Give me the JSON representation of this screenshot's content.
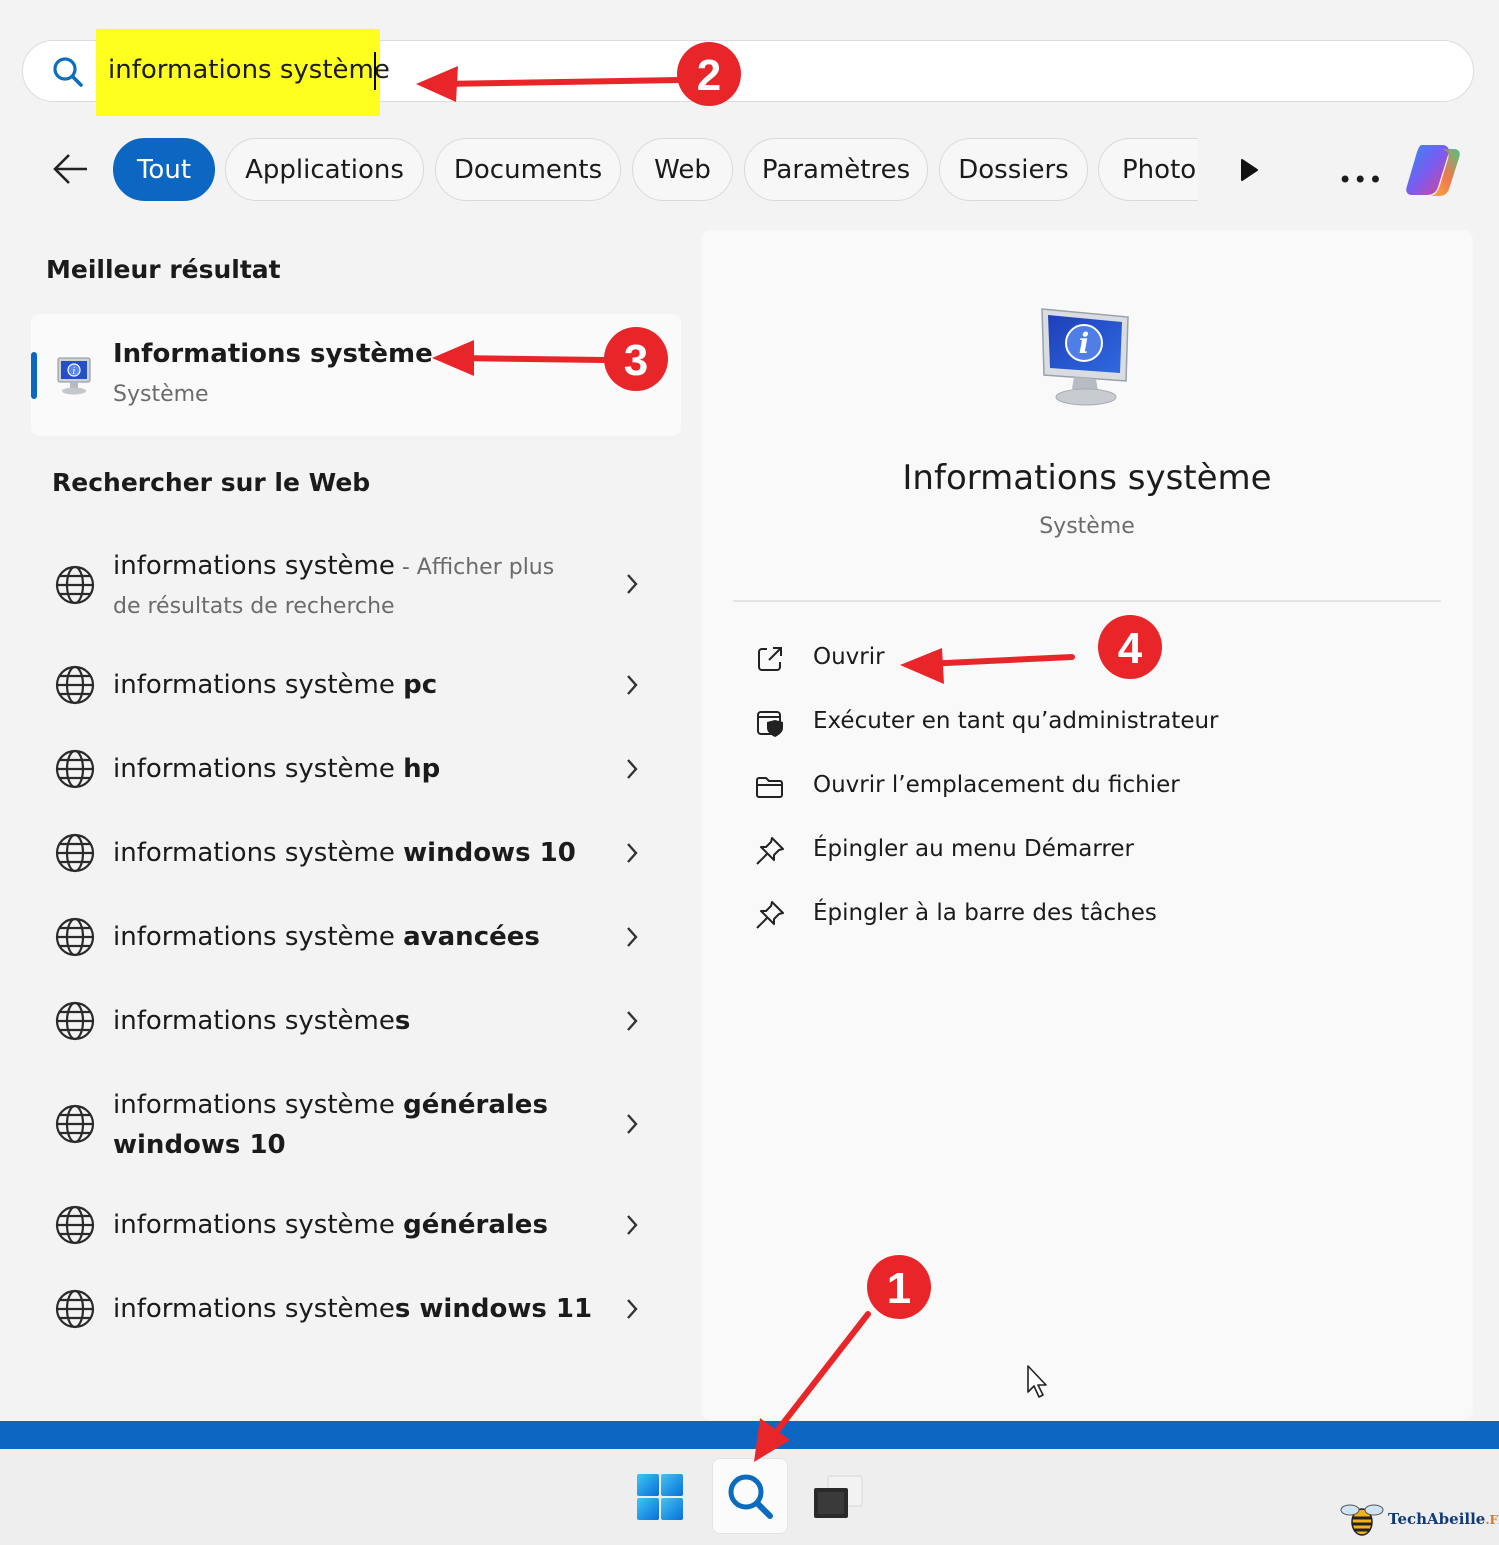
{
  "search": {
    "query": "informations système"
  },
  "filters": {
    "tabs": [
      "Tout",
      "Applications",
      "Documents",
      "Web",
      "Paramètres",
      "Dossiers",
      "Photo"
    ],
    "active": "Tout"
  },
  "left": {
    "best_heading": "Meilleur résultat",
    "best": {
      "title": "Informations système",
      "subtitle": "Système"
    },
    "web_heading": "Rechercher sur le Web",
    "web_results": [
      {
        "normal": "informations système",
        "bold": "",
        "suffix": " - Afficher plus",
        "line2": "de résultats de recherche"
      },
      {
        "normal": "informations système ",
        "bold": "pc"
      },
      {
        "normal": "informations système ",
        "bold": "hp"
      },
      {
        "normal": "informations système ",
        "bold": "windows 10"
      },
      {
        "normal": "informations système ",
        "bold": "avancées"
      },
      {
        "normal": "informations système",
        "bold": "s"
      },
      {
        "normal": "informations système ",
        "bold": "générales",
        "line2_bold": "windows 10"
      },
      {
        "normal": "informations système ",
        "bold": "générales"
      },
      {
        "normal": "informations système",
        "bold": "s windows 11"
      }
    ]
  },
  "right": {
    "title": "Informations système",
    "subtitle": "Système",
    "actions": [
      {
        "label": "Ouvrir",
        "icon": "open-external-icon"
      },
      {
        "label": "Exécuter en tant qu’administrateur",
        "icon": "admin-shield-icon"
      },
      {
        "label": "Ouvrir l’emplacement du fichier",
        "icon": "folder-icon"
      },
      {
        "label": "Épingler au menu Démarrer",
        "icon": "pin-icon"
      },
      {
        "label": "Épingler à la barre des tâches",
        "icon": "pin-icon"
      }
    ]
  },
  "annotations": [
    "1",
    "2",
    "3",
    "4"
  ],
  "brand": {
    "name": "TechAbeille",
    "tld": ".FR"
  },
  "colors": {
    "accent": "#0b67c2",
    "highlight": "#ffff1f",
    "annotation": "#e8262a"
  }
}
